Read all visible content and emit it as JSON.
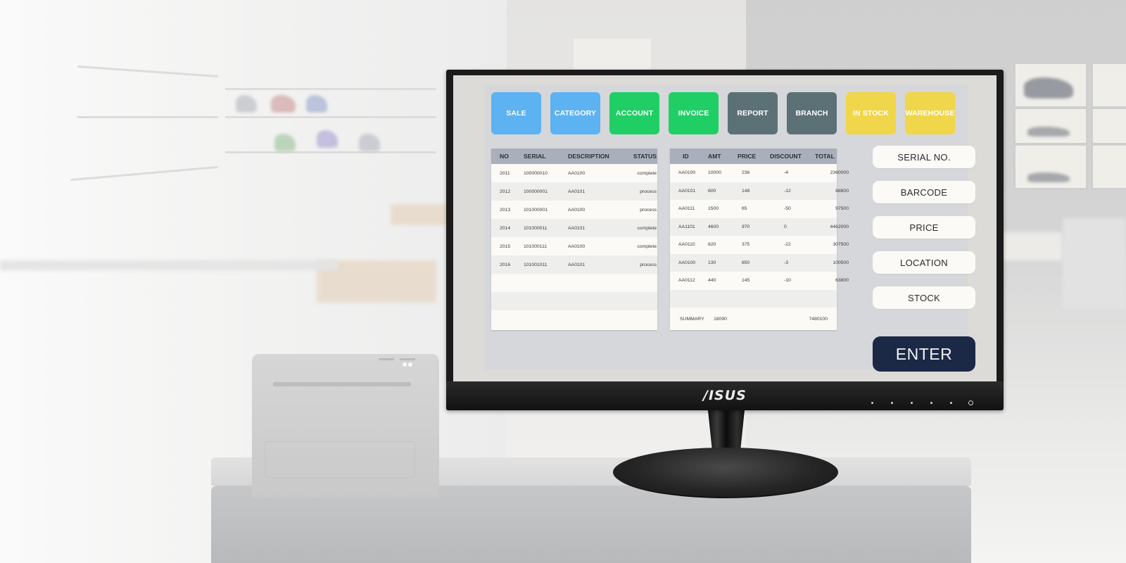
{
  "colors": {
    "tile_blue": "#5db2f1",
    "tile_green": "#1fcf66",
    "tile_slate": "#5c7175",
    "tile_yellow": "#f0d64a",
    "table_header": "#a9afbb",
    "enter_button": "#1b2846",
    "screen_bg": "#dddbd8"
  },
  "monitor": {
    "brand": "/ISUS"
  },
  "pos": {
    "tiles": [
      {
        "label": "SALE",
        "color": "blue"
      },
      {
        "label": "CATEGORY",
        "color": "blue"
      },
      {
        "label": "ACCOUNT",
        "color": "green"
      },
      {
        "label": "INVOICE",
        "color": "green"
      },
      {
        "label": "REPORT",
        "color": "slate"
      },
      {
        "label": "BRANCH",
        "color": "slate"
      },
      {
        "label": "IN STOCK",
        "color": "yellow"
      },
      {
        "label": "WAREHOUSE",
        "color": "yellow"
      }
    ],
    "orders_table": {
      "columns": [
        "NO",
        "SERIAL",
        "DESCRIPTION",
        "STATUS"
      ],
      "rows": [
        [
          "2011",
          "100000010",
          "AA0100",
          "complete"
        ],
        [
          "2012",
          "100000001",
          "AA0101",
          "process"
        ],
        [
          "2013",
          "101000001",
          "AA0100",
          "process"
        ],
        [
          "2014",
          "101000011",
          "AA0101",
          "complete"
        ],
        [
          "2015",
          "101000111",
          "AA0100",
          "complete"
        ],
        [
          "2016",
          "101001011",
          "AA0101",
          "process"
        ],
        [
          "",
          "",
          "",
          ""
        ],
        [
          "",
          "",
          "",
          ""
        ],
        [
          "",
          "",
          "",
          ""
        ]
      ]
    },
    "items_table": {
      "columns": [
        "ID",
        "AMT",
        "PRICE",
        "DISCOUNT",
        "TOTAL"
      ],
      "rows": [
        [
          "AA0100",
          "10000",
          "236",
          "-4",
          "2360000"
        ],
        [
          "AA0101",
          "600",
          "148",
          "-12",
          "88800"
        ],
        [
          "AA0111",
          "1500",
          "65",
          "-50",
          "97500"
        ],
        [
          "AA1101",
          "4600",
          "970",
          "0",
          "4462000"
        ],
        [
          "AA0110",
          "820",
          "375",
          "-22",
          "307500"
        ],
        [
          "AA0100",
          "130",
          "850",
          "-3",
          "100500"
        ],
        [
          "AA0112",
          "440",
          "145",
          "-10",
          "63800"
        ],
        [
          "",
          "",
          "",
          "",
          ""
        ]
      ],
      "summary": {
        "label": "SUMMARY",
        "amt": "18090",
        "total": "7480100"
      }
    },
    "side_buttons": [
      "SERIAL NO.",
      "BARCODE",
      "PRICE",
      "LOCATION",
      "STOCK"
    ],
    "enter_label": "ENTER"
  }
}
